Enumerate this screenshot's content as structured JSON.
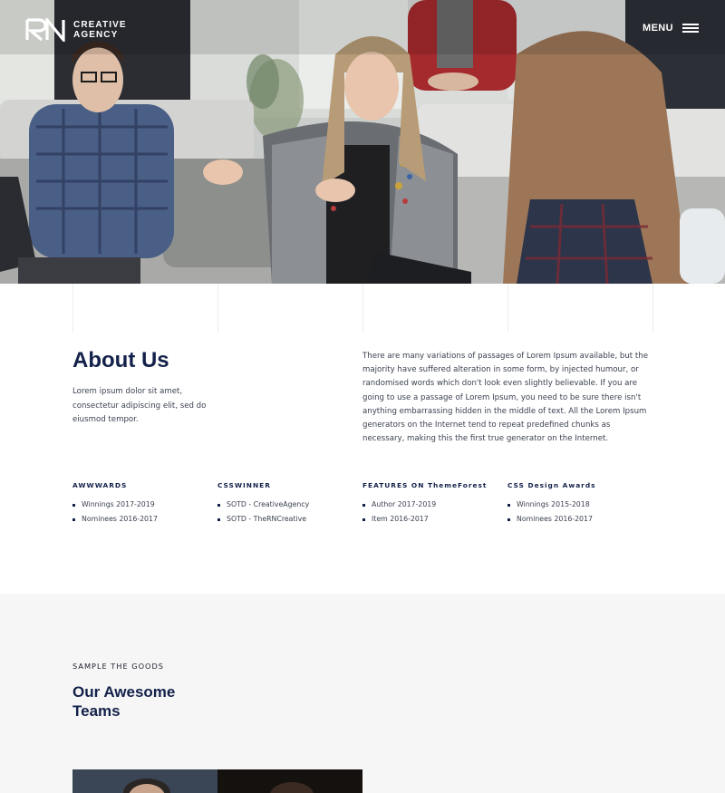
{
  "brand": {
    "line1": "CREATIVE",
    "line2": "AGENCY"
  },
  "nav": {
    "menu_label": "MENU",
    "menu_icon": "hamburger-icon"
  },
  "hero": {
    "image": "team-meeting-photo"
  },
  "about": {
    "title": "About Us",
    "lead": "Lorem ipsum dolor sit amet, consectetur adipiscing elit, sed do eiusmod tempor.",
    "body": "There are many variations of passages of Lorem Ipsum available, but the majority have suffered alteration in some form, by injected humour, or randomised words which don't look even slightly believable. If you are going to use a passage of Lorem Ipsum, you need to be sure there isn't anything embarrassing hidden in the middle of text. All the Lorem Ipsum generators on the Internet tend to repeat predefined chunks as necessary, making this the first true generator on the Internet."
  },
  "awards": [
    {
      "title": "AWWWARDS",
      "items": [
        "Winnings 2017-2019",
        "Nominees 2016-2017"
      ]
    },
    {
      "title": "CSSWINNER",
      "items": [
        "SOTD - CreativeAgency",
        "SOTD - TheRNCreative"
      ]
    },
    {
      "title": "FEATURES ON ThemeForest",
      "items": [
        "Author 2017-2019",
        "Item 2016-2017"
      ]
    },
    {
      "title": "CSS Design Awards",
      "items": [
        "Winnings 2015-2018",
        "Nominees 2016-2017"
      ]
    }
  ],
  "teams": {
    "kicker": "SAMPLE THE GOODS",
    "title": "Our Awesome Teams"
  },
  "colors": {
    "navy": "#13214a",
    "text": "#3b4150",
    "section_bg": "#f6f6f6"
  }
}
